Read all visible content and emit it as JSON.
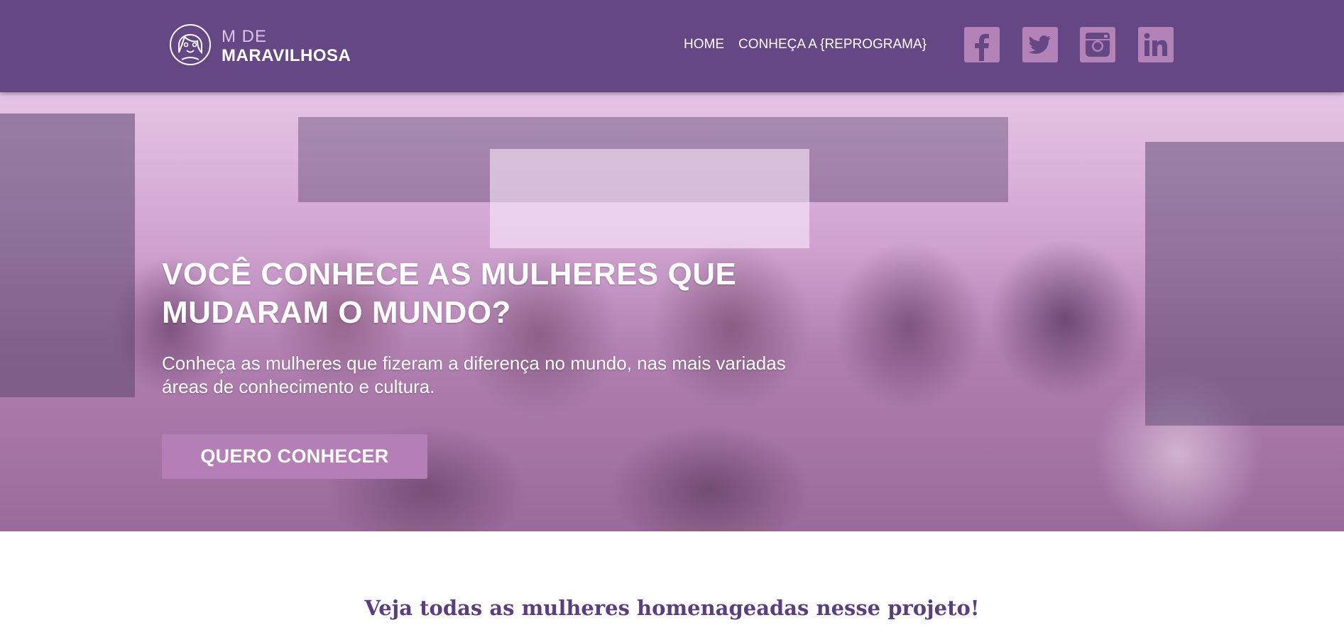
{
  "header": {
    "logo": {
      "top": "M DE",
      "bottom": "MARAVILHOSA",
      "icon": "woman-face-icon"
    },
    "nav": [
      {
        "label": "HOME"
      },
      {
        "label": "CONHEÇA A {REPROGRAMA}"
      }
    ],
    "social": [
      {
        "name": "facebook",
        "icon": "facebook-icon"
      },
      {
        "name": "twitter",
        "icon": "twitter-icon"
      },
      {
        "name": "instagram",
        "icon": "instagram-icon"
      },
      {
        "name": "linkedin",
        "icon": "linkedin-icon"
      }
    ]
  },
  "hero": {
    "title": "VOCÊ CONHECE AS MULHERES QUE MUDARAM O MUNDO?",
    "subtitle": "Conheça as mulheres que fizeram a diferença no mundo, nas mais variadas áreas de conhecimento e cultura.",
    "button_label": "QUERO CONHECER"
  },
  "section": {
    "title": "Veja todas as mulheres homenageadas nesse projeto!"
  },
  "colors": {
    "header_bg": "#644784",
    "accent": "#b37fb6",
    "section_title": "#5b3f7d"
  }
}
